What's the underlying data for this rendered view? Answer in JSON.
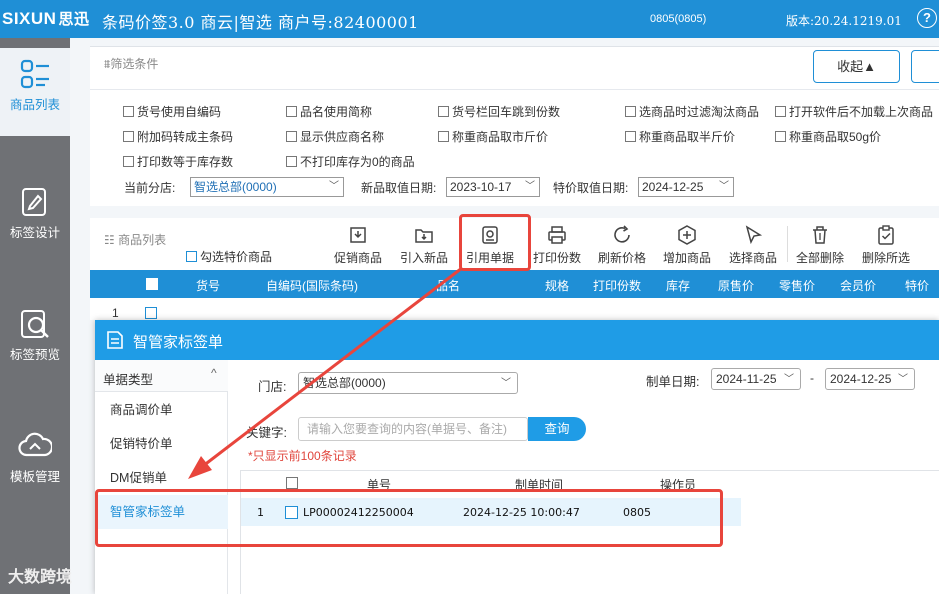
{
  "titlebar": {
    "logo_text": "SIXUN",
    "logo_cn": "思迅",
    "app_title": "条码价签3.0   商云|智选   商户号:82400001",
    "user": "0805(0805)",
    "version": "版本:20.24.1219.01",
    "help": "?"
  },
  "sidebar": {
    "items": [
      {
        "label": "商品列表",
        "icon": "list-icon"
      },
      {
        "label": "标签设计",
        "icon": "pen-icon"
      },
      {
        "label": "标签预览",
        "icon": "magnifier-icon"
      },
      {
        "label": "模板管理",
        "icon": "cloud-icon"
      }
    ]
  },
  "filter": {
    "title": "筛选条件",
    "collapse_label": "收起▲",
    "checkboxes": [
      "货号使用自编码",
      "品名使用简称",
      "货号栏回车跳到份数",
      "选商品时过滤淘汰商品",
      "打开软件后不加载上次商品",
      "附加码转成主条码",
      "显示供应商名称",
      "称重商品取市斤价",
      "称重商品取半斤价",
      "称重商品取50g价",
      "打印数等于库存数",
      "不打印库存为0的商品"
    ],
    "branch_label": "当前分店:",
    "branch_value": "智选总部(0000)",
    "price_date_label": "新品取值日期:",
    "price_date_value": "2023-10-17",
    "special_date_label": "特价取值日期:",
    "special_date_value": "2024-12-25"
  },
  "product_list": {
    "title": "商品列表",
    "special_checkbox": "勾选特价商品",
    "toolbar": [
      {
        "label": "促销商品",
        "icon": "promo-icon"
      },
      {
        "label": "引入新品",
        "icon": "import-icon"
      },
      {
        "label": "引用单据",
        "icon": "document-ref-icon"
      },
      {
        "label": "打印份数",
        "icon": "printer-icon"
      },
      {
        "label": "刷新价格",
        "icon": "refresh-icon"
      },
      {
        "label": "增加商品",
        "icon": "add-icon"
      },
      {
        "label": "选择商品",
        "icon": "cursor-icon"
      },
      {
        "label": "全部删除",
        "icon": "trash-icon"
      },
      {
        "label": "删除所选",
        "icon": "clipboard-check-icon"
      }
    ],
    "columns": [
      "货号",
      "自编码(国际条码)",
      "品名",
      "规格",
      "打印份数",
      "库存",
      "原售价",
      "零售价",
      "会员价",
      "特价"
    ],
    "first_row_number": "1"
  },
  "dialog": {
    "title": "智管家标签单",
    "doc_type_title": "单据类型",
    "doc_type_caret": "^",
    "doc_types": [
      "商品调价单",
      "促销特价单",
      "DM促销单",
      "智管家标签单"
    ],
    "store_label": "门店:",
    "store_value": "智选总部(0000)",
    "date_label": "制单日期:",
    "date_from": "2024-11-25",
    "date_sep": "-",
    "date_to": "2024-12-25",
    "keyword_label": "关键字:",
    "keyword_placeholder": "请输入您要查询的内容(单据号、备注)",
    "query_label": "查询",
    "note": "*只显示前100条记录",
    "columns": [
      "单号",
      "制单时间",
      "操作员"
    ],
    "rows": [
      {
        "index": "1",
        "doc_no": "LP00002412250004",
        "time": "2024-12-25 10:00:47",
        "operator": "0805"
      }
    ]
  },
  "watermark": "大数跨境",
  "colors": {
    "primary": "#1f8fd6",
    "annotation_red": "#e8453c",
    "sidebar": "#6f7175"
  }
}
